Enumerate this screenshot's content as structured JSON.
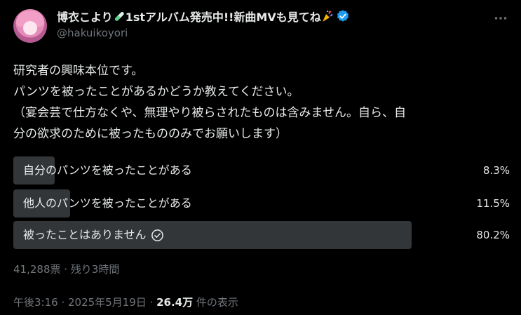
{
  "author": {
    "display_name": "博衣こより",
    "name_suffix": "1stアルバム発売中!!新曲MV",
    "name_suffix2": "も見てね",
    "handle": "@hakuikoyori",
    "verified": true,
    "avatar_icon": "avatar-image",
    "name_emojis": [
      "test-tube-icon",
      "party-popper-icon"
    ]
  },
  "tweet": {
    "lines": [
      "研究者の興味本位です。",
      "パンツを被ったことがあるかどうか教えてください。",
      "（宴会芸で仕方なくや、無理やり被らされたものは含みません。自ら、自",
      "分の欲求のために被ったもののみでお願いします）"
    ]
  },
  "poll": {
    "options": [
      {
        "label": "自分のパンツを被ったことがある",
        "percent_text": "8.3%",
        "percent": 8.3,
        "selected": false
      },
      {
        "label": "他人のパンツを被ったことがある",
        "percent_text": "11.5%",
        "percent": 11.5,
        "selected": false
      },
      {
        "label": "被ったことはありません",
        "percent_text": "80.2%",
        "percent": 80.2,
        "selected": true
      }
    ],
    "meta": "41,288票 · 残り3時間"
  },
  "footer": {
    "time": "午後3:16 · 2025年5月19日 · ",
    "views_count": "26.4万",
    "views_label": " 件の表示"
  },
  "colors": {
    "background": "#000000",
    "text": "#e7e9ea",
    "muted": "#71767b",
    "bar": "#333639",
    "verified": "#1d9bf0"
  }
}
